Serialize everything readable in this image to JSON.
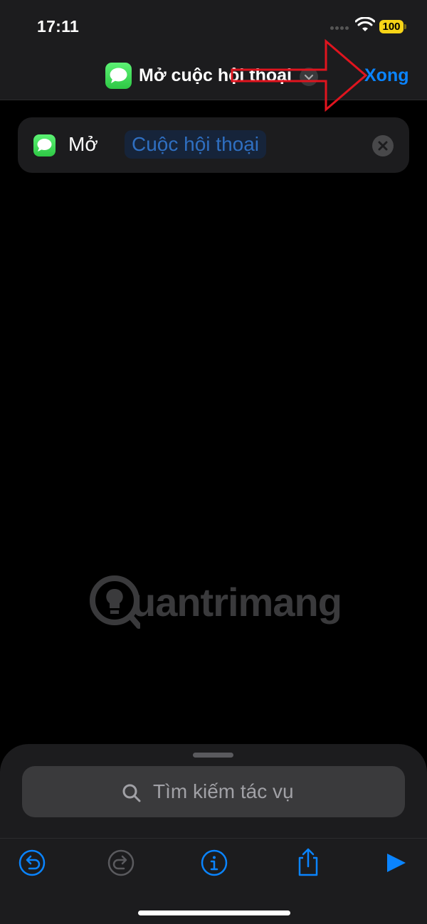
{
  "status_bar": {
    "time": "17:11",
    "battery": "100"
  },
  "navbar": {
    "title": "Mở cuộc hội thoại",
    "done_label": "Xong",
    "app_icon": "messages-icon"
  },
  "action_card": {
    "verb": "Mở",
    "parameter": "Cuộc hội thoại",
    "app_icon": "messages-icon"
  },
  "watermark": {
    "text": "uantrimang"
  },
  "search": {
    "placeholder": "Tìm kiếm tác vụ"
  },
  "toolbar": {
    "icons": [
      "undo-icon",
      "redo-icon",
      "info-icon",
      "share-icon",
      "play-icon"
    ]
  },
  "colors": {
    "accent": "#0a84ff",
    "messages_green": "#34c759",
    "battery_yellow": "#f7d417",
    "annotation_red": "#e0141e"
  }
}
